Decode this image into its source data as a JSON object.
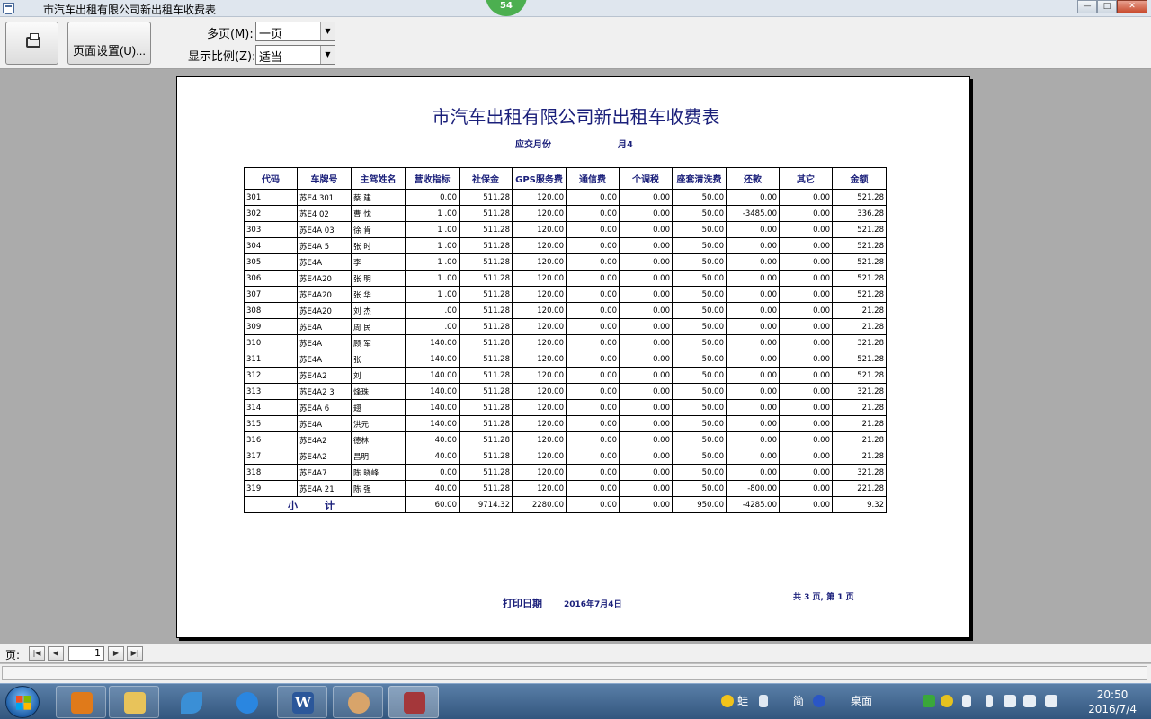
{
  "window": {
    "title": "市汽车出租有限公司新出租车收费表",
    "badge": "54"
  },
  "toolbar": {
    "print_icon": "printer-icon",
    "setup_label": "页面设置(U)...",
    "multipage_label": "多页(M):",
    "multipage_value": "一页",
    "zoom_label": "显示比例(Z):",
    "zoom_value": "适当"
  },
  "report": {
    "title": "市汽车出租有限公司新出租车收费表",
    "month_label": "应交月份",
    "month_value": "月4",
    "columns": [
      "代码",
      "车牌号",
      "主驾姓名",
      "营收指标",
      "社保金",
      "GPS服务费",
      "通信费",
      "个调税",
      "座套清洗费",
      "还款",
      "其它",
      "金额"
    ],
    "rows": [
      [
        "301",
        "苏E4  301",
        "蔡  建",
        "0.00",
        "511.28",
        "120.00",
        "0.00",
        "0.00",
        "50.00",
        "0.00",
        "0.00",
        "521.28"
      ],
      [
        "302",
        "苏E4  02",
        "曹  忱",
        "1  .00",
        "511.28",
        "120.00",
        "0.00",
        "0.00",
        "50.00",
        "-3485.00",
        "0.00",
        "336.28"
      ],
      [
        "303",
        "苏E4A  03",
        "徐  肯",
        "1  .00",
        "511.28",
        "120.00",
        "0.00",
        "0.00",
        "50.00",
        "0.00",
        "0.00",
        "521.28"
      ],
      [
        "304",
        "苏E4A  5",
        "张  时",
        "1  .00",
        "511.28",
        "120.00",
        "0.00",
        "0.00",
        "50.00",
        "0.00",
        "0.00",
        "521.28"
      ],
      [
        "305",
        "苏E4A",
        "李",
        "1  .00",
        "511.28",
        "120.00",
        "0.00",
        "0.00",
        "50.00",
        "0.00",
        "0.00",
        "521.28"
      ],
      [
        "306",
        "苏E4A20",
        "张  明",
        "1  .00",
        "511.28",
        "120.00",
        "0.00",
        "0.00",
        "50.00",
        "0.00",
        "0.00",
        "521.28"
      ],
      [
        "307",
        "苏E4A20",
        "张  华",
        "1  .00",
        "511.28",
        "120.00",
        "0.00",
        "0.00",
        "50.00",
        "0.00",
        "0.00",
        "521.28"
      ],
      [
        "308",
        "苏E4A20",
        "刘  杰",
        "  .00",
        "511.28",
        "120.00",
        "0.00",
        "0.00",
        "50.00",
        "0.00",
        "0.00",
        "21.28"
      ],
      [
        "309",
        "苏E4A",
        "周  民",
        "  .00",
        "511.28",
        "120.00",
        "0.00",
        "0.00",
        "50.00",
        "0.00",
        "0.00",
        "21.28"
      ],
      [
        "310",
        "苏E4A",
        "顾  军",
        "140.00",
        "511.28",
        "120.00",
        "0.00",
        "0.00",
        "50.00",
        "0.00",
        "0.00",
        "321.28"
      ],
      [
        "311",
        "苏E4A",
        "张",
        "140.00",
        "511.28",
        "120.00",
        "0.00",
        "0.00",
        "50.00",
        "0.00",
        "0.00",
        "521.28"
      ],
      [
        "312",
        "苏E4A2",
        "刘",
        "140.00",
        "511.28",
        "120.00",
        "0.00",
        "0.00",
        "50.00",
        "0.00",
        "0.00",
        "521.28"
      ],
      [
        "313",
        "苏E4A2  3",
        "  烽珠",
        "140.00",
        "511.28",
        "120.00",
        "0.00",
        "0.00",
        "50.00",
        "0.00",
        "0.00",
        "321.28"
      ],
      [
        "314",
        "苏E4A  6",
        "  翅",
        "140.00",
        "511.28",
        "120.00",
        "0.00",
        "0.00",
        "50.00",
        "0.00",
        "0.00",
        "21.28"
      ],
      [
        "315",
        "苏E4A",
        "  洪元",
        "140.00",
        "511.28",
        "120.00",
        "0.00",
        "0.00",
        "50.00",
        "0.00",
        "0.00",
        "21.28"
      ],
      [
        "316",
        "苏E4A2",
        "  德林",
        "40.00",
        "511.28",
        "120.00",
        "0.00",
        "0.00",
        "50.00",
        "0.00",
        "0.00",
        "21.28"
      ],
      [
        "317",
        "苏E4A2",
        "  昌明",
        "40.00",
        "511.28",
        "120.00",
        "0.00",
        "0.00",
        "50.00",
        "0.00",
        "0.00",
        "21.28"
      ],
      [
        "318",
        "苏E4A7",
        "陈  晓峰",
        "0.00",
        "511.28",
        "120.00",
        "0.00",
        "0.00",
        "50.00",
        "0.00",
        "0.00",
        "321.28"
      ],
      [
        "319",
        "苏E4A  21",
        "陈  强",
        "40.00",
        "511.28",
        "120.00",
        "0.00",
        "0.00",
        "50.00",
        "-800.00",
        "0.00",
        "221.28"
      ]
    ],
    "total": {
      "label": "小计",
      "values": [
        "60.00",
        "9714.32",
        "2280.00",
        "0.00",
        "0.00",
        "950.00",
        "-4285.00",
        "0.00",
        "9.32"
      ]
    },
    "print_date_label": "打印日期",
    "print_date_value": "2016年7月4日",
    "page_info": "共 3 页, 第 1 页"
  },
  "pagenav": {
    "label": "页:",
    "current": "1"
  },
  "taskbar": {
    "tray_text_1": "蛙",
    "tray_text_2": "简",
    "tray_text_3": "桌面",
    "time": "20:50",
    "date": "2016/7/4"
  }
}
